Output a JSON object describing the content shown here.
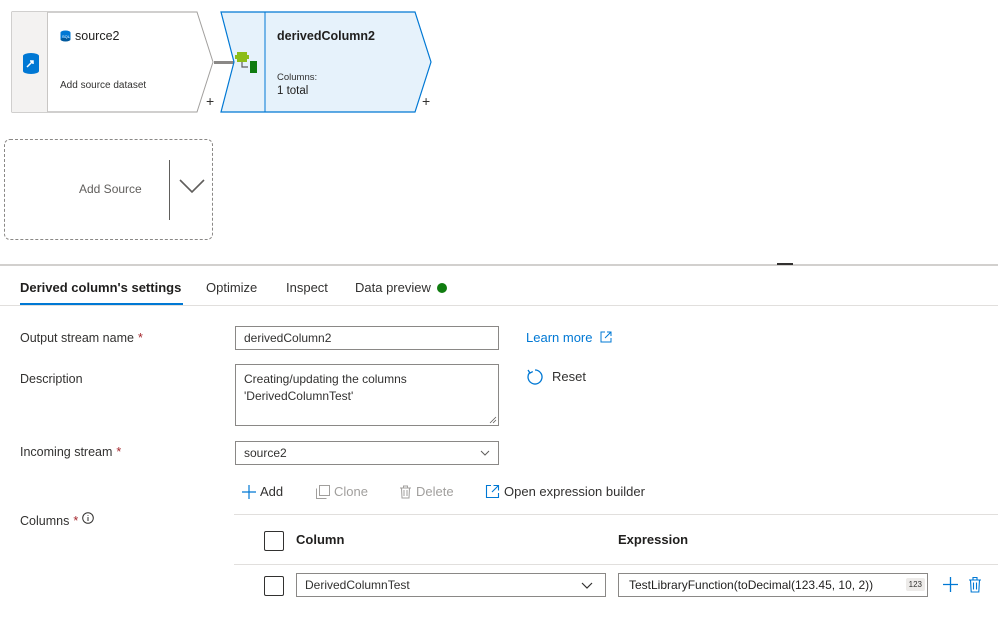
{
  "canvas": {
    "source_node": {
      "title": "source2",
      "subtitle": "Add source dataset",
      "icon": "sql-database-icon",
      "type_icon": "source-transform-icon"
    },
    "derived_node": {
      "title": "derivedColumn2",
      "columns_label": "Columns:",
      "columns_value": "1 total",
      "icon": "derived-column-icon"
    },
    "add_source": {
      "label": "Add Source"
    },
    "add_label": "+"
  },
  "tabs": [
    {
      "label": "Derived column's settings",
      "active": true
    },
    {
      "label": "Optimize"
    },
    {
      "label": "Inspect"
    },
    {
      "label": "Data preview",
      "status": "green-dot"
    }
  ],
  "settings": {
    "output_stream": {
      "label": "Output stream name",
      "required": "*",
      "value": "derivedColumn2"
    },
    "description": {
      "label": "Description",
      "value": "Creating/updating the columns 'DerivedColumnTest'"
    },
    "incoming_stream": {
      "label": "Incoming stream",
      "required": "*",
      "value": "source2"
    },
    "columns": {
      "label": "Columns",
      "required": "*"
    },
    "learn_more": "Learn more",
    "reset": "Reset"
  },
  "toolbar": {
    "add": "Add",
    "clone": "Clone",
    "delete": "Delete",
    "open_builder": "Open expression builder"
  },
  "grid": {
    "headers": {
      "column": "Column",
      "expression": "Expression"
    },
    "rows": [
      {
        "column": "DerivedColumnTest",
        "expression": "TestLibraryFunction(toDecimal(123.45, 10, 2))",
        "type_badge": "123"
      }
    ]
  },
  "colors": {
    "accent": "#0078d4",
    "status_ok": "#107c10",
    "required": "#a4262c"
  }
}
